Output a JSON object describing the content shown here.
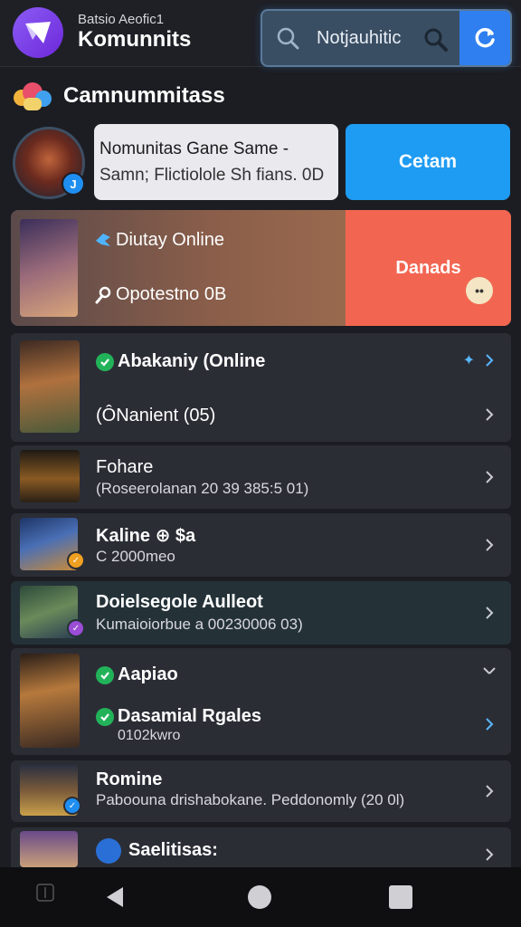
{
  "header": {
    "subtitle": "Batsio Aeofic1",
    "title": "Komunnits",
    "search_text": "Notjauhitic"
  },
  "section": {
    "title": "Camnummitass"
  },
  "featured": {
    "badge": "J",
    "title": "Nomunitas Gane Same -",
    "subtitle": "Samn; Flictiolole Sh fians. 0D",
    "button_label": "Cetam"
  },
  "highlight": {
    "title": "Diutay Online",
    "subtitle": "Opotestno 0B",
    "button_label": "Danads"
  },
  "list": [
    {
      "title": "Abakaniy (Online",
      "sub": "(ÔNanient (05)"
    },
    {
      "title": "Fohare",
      "sub": "(Roseerolanan 20 39 385:5 01)"
    },
    {
      "title": "Kaline ⊕ $a",
      "sub": "C 2000meo"
    },
    {
      "title": "Doielsegole Aulleot",
      "sub": "Kumaioiorbue a 00230006 03)"
    },
    {
      "title": "Aapiao",
      "title2": "Dasamial Rgales",
      "sub": "0102kwro"
    },
    {
      "title": "Romine",
      "sub": "Paboouna drishabokane. Peddonomly (20 0l)"
    },
    {
      "title": "Saelitisas:",
      "sub": ""
    }
  ],
  "colors": {
    "accent_blue": "#1e9bf2",
    "accent_coral": "#f26651",
    "check_green": "#22b35a",
    "logo_purple": "#7c3aed"
  }
}
